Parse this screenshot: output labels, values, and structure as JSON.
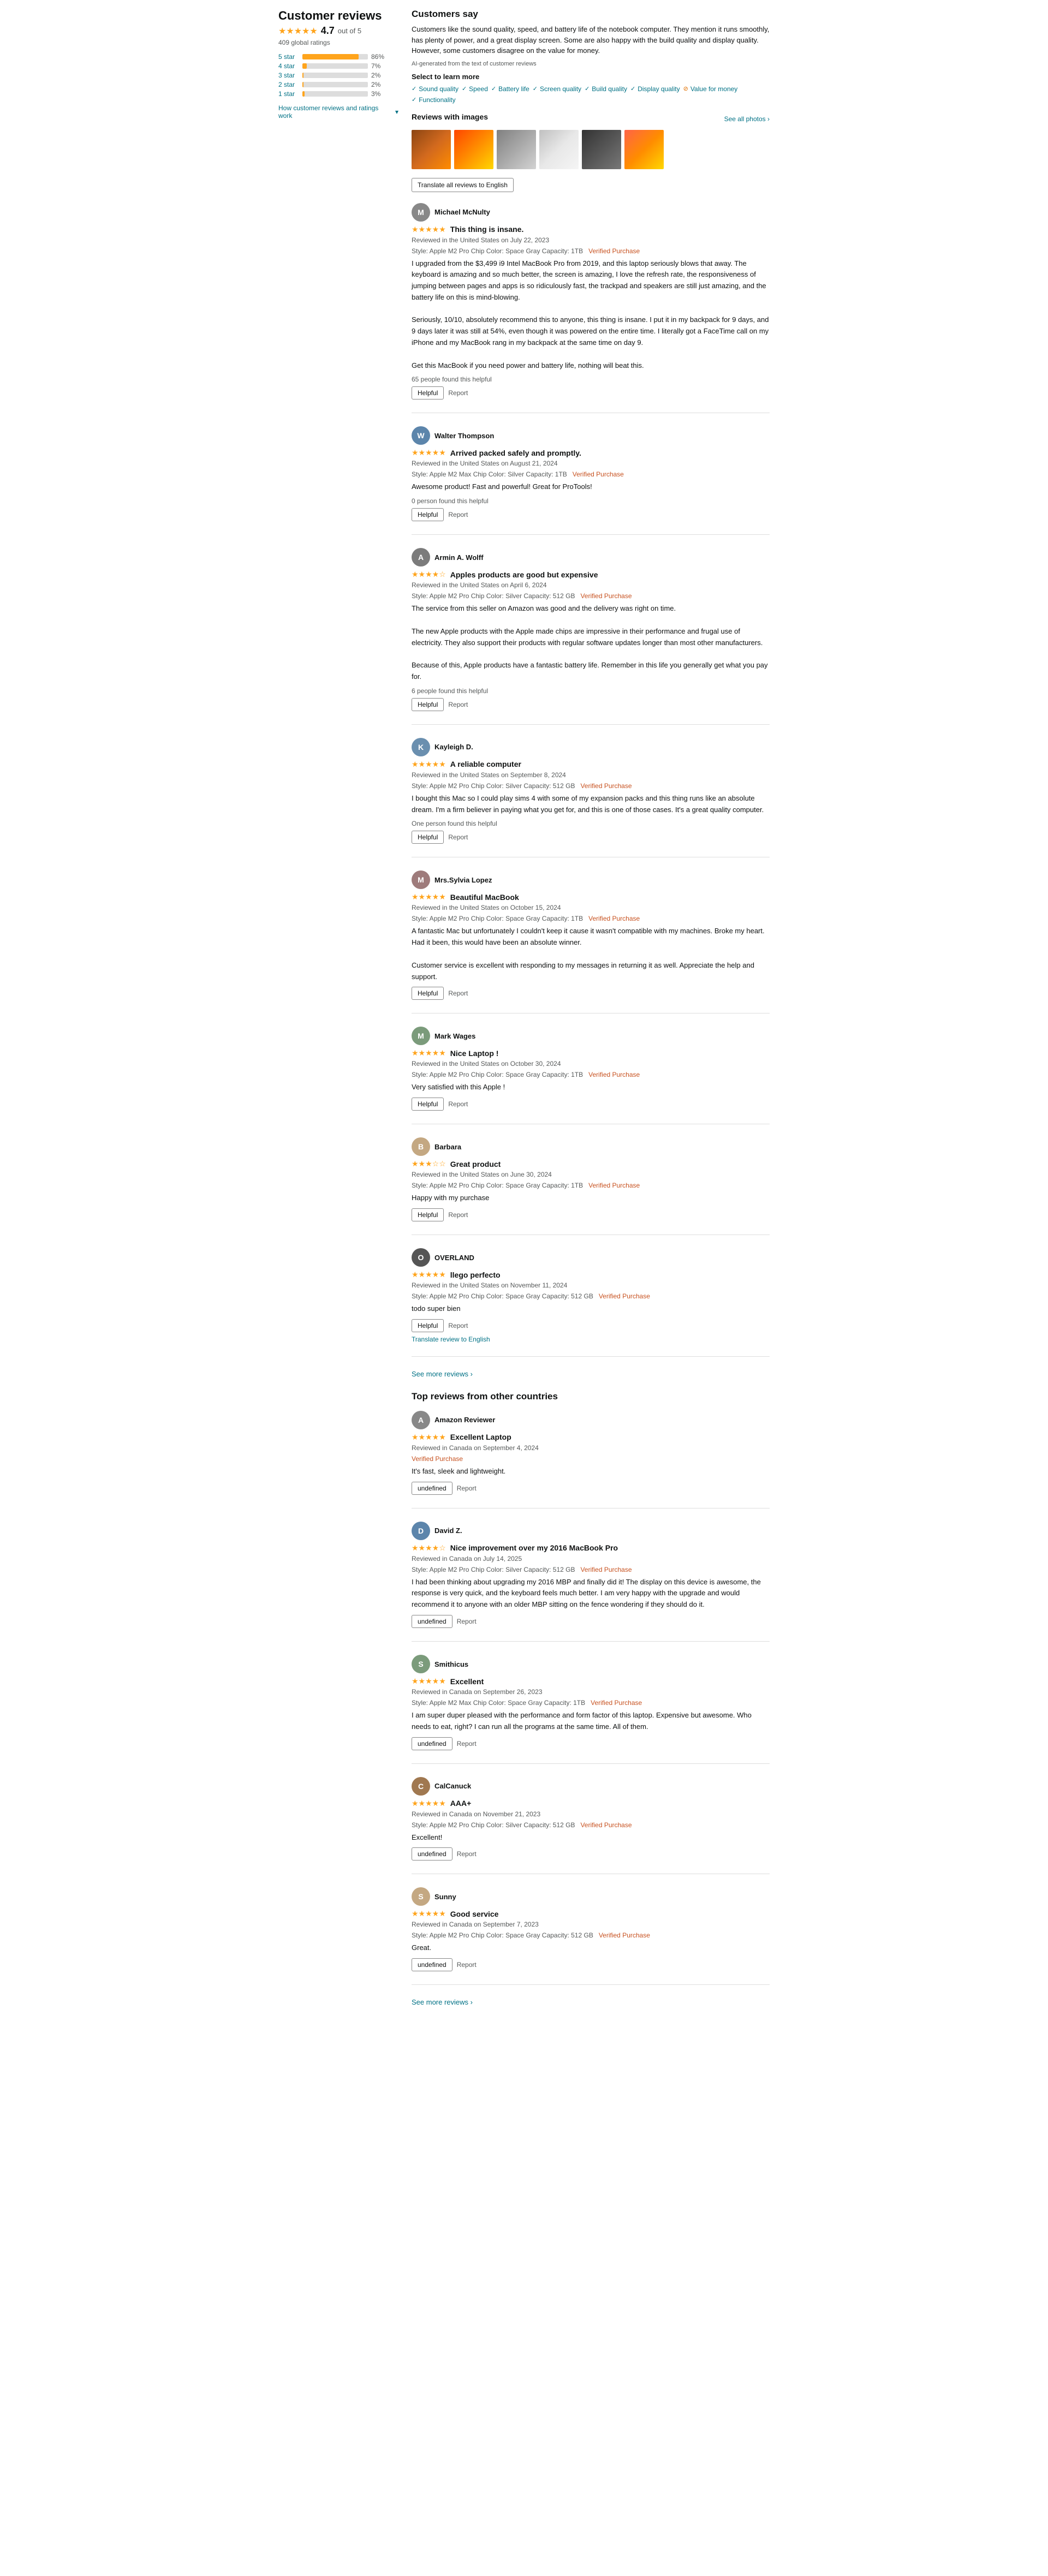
{
  "sidebar": {
    "title": "Customer reviews",
    "rating": "4.7",
    "out_of": "out of 5",
    "total_ratings": "409 global ratings",
    "how_work_label": "How customer reviews and ratings work",
    "stars": [
      {
        "label": "5 star",
        "pct": 86,
        "pct_label": "86%"
      },
      {
        "label": "4 star",
        "pct": 7,
        "pct_label": "7%"
      },
      {
        "label": "3 star",
        "pct": 2,
        "pct_label": "2%"
      },
      {
        "label": "2 star",
        "pct": 2,
        "pct_label": "2%"
      },
      {
        "label": "1 star",
        "pct": 3,
        "pct_label": "3%"
      }
    ]
  },
  "customers_say": {
    "header": "Customers say",
    "body": "Customers like the sound quality, speed, and battery life of the notebook computer. They mention it runs smoothly, has plenty of power, and a great display screen. Some are also happy with the build quality and display quality. However, some customers disagree on the value for money.",
    "ai_note": "AI-generated from the text of customer reviews",
    "select_learn": "Select to learn more",
    "tags": [
      {
        "label": "Sound quality",
        "type": "check"
      },
      {
        "label": "Speed",
        "type": "check"
      },
      {
        "label": "Battery life",
        "type": "check"
      },
      {
        "label": "Screen quality",
        "type": "check"
      },
      {
        "label": "Build quality",
        "type": "check"
      },
      {
        "label": "Display quality",
        "type": "check"
      },
      {
        "label": "Value for money",
        "type": "warn"
      },
      {
        "label": "Functionality",
        "type": "check"
      }
    ]
  },
  "reviews_images": {
    "header": "Reviews with images",
    "see_all": "See all photos ›",
    "translate_btn": "Translate all reviews to English"
  },
  "reviews": [
    {
      "id": 1,
      "avatar_letter": "M",
      "avatar_bg": "#888",
      "reviewer": "Michael McNulty",
      "stars": 5,
      "title": "This thing is insane.",
      "date": "Reviewed in the United States on July 22, 2023",
      "style": "Style: Apple M2 Pro Chip   Color: Space Gray   Capacity: 1TB",
      "verified": "Verified Purchase",
      "body": "I upgraded from the $3,499 i9 Intel MacBook Pro from 2019, and this laptop seriously blows that away. The keyboard is amazing and so much better, the screen is amazing, I love the refresh rate, the responsiveness of jumping between pages and apps is so ridiculously fast, the trackpad and speakers are still just amazing, and the battery life on this is mind-blowing.\n\nSeriously, 10/10, absolutely recommend this to anyone, this thing is insane. I put it in my backpack for 9 days, and 9 days later it was still at 54%, even though it was powered on the entire time. I literally got a FaceTime call on my iPhone and my MacBook rang in my backpack at the same time on day 9.\n\nGet this MacBook if you need power and battery life, nothing will beat this.",
      "helpful_count": "65 people found this helpful",
      "helpful_label": "Helpful",
      "report_label": "Report"
    },
    {
      "id": 2,
      "avatar_letter": "W",
      "avatar_bg": "#5C85AB",
      "reviewer": "Walter Thompson",
      "stars": 5,
      "title": "Arrived packed safely and promptly.",
      "date": "Reviewed in the United States on August 21, 2024",
      "style": "Style: Apple M2 Max Chip   Color: Silver   Capacity: 1TB",
      "verified": "Verified Purchase",
      "body": "Awesome product! Fast and powerful! Great for ProTools!",
      "helpful_count": "0 person found this helpful",
      "helpful_label": "Helpful",
      "report_label": "Report"
    },
    {
      "id": 3,
      "avatar_letter": "A",
      "avatar_bg": "#7B7B7B",
      "reviewer": "Armin A. Wolff",
      "stars": 4,
      "title": "Apples products are good but expensive",
      "date": "Reviewed in the United States on April 6, 2024",
      "style": "Style: Apple M2 Pro Chip   Color: Silver   Capacity: 512 GB",
      "verified": "Verified Purchase",
      "body": "The service from this seller on Amazon was good and the delivery was right on time.\n\nThe new Apple products with the Apple made chips are impressive in their performance and frugal use of electricity. They also support their products with regular software updates longer than most other manufacturers.\n\nBecause of this, Apple products have a fantastic battery life. Remember in this life you generally get what you pay for.",
      "helpful_count": "6 people found this helpful",
      "helpful_label": "Helpful",
      "report_label": "Report"
    },
    {
      "id": 4,
      "avatar_letter": "K",
      "avatar_bg": "#6A8FAF",
      "reviewer": "Kayleigh D.",
      "stars": 5,
      "title": "A reliable computer",
      "date": "Reviewed in the United States on September 8, 2024",
      "style": "Style: Apple M2 Pro Chip   Color: Silver   Capacity: 512 GB",
      "verified": "Verified Purchase",
      "body": "I bought this Mac so I could play sims 4 with some of my expansion packs and this thing runs like an absolute dream. I'm a firm believer in paying what you get for, and this is one of those cases. It's a great quality computer.",
      "helpful_count": "One person found this helpful",
      "helpful_label": "Helpful",
      "report_label": "Report"
    },
    {
      "id": 5,
      "avatar_letter": "M",
      "avatar_bg": "#9E7B7B",
      "reviewer": "Mrs.Sylvia Lopez",
      "stars": 5,
      "title": "Beautiful MacBook",
      "date": "Reviewed in the United States on October 15, 2024",
      "style": "Style: Apple M2 Pro Chip   Color: Space Gray   Capacity: 1TB",
      "verified": "Verified Purchase",
      "body": "A fantastic Mac but unfortunately I couldn't keep it cause it wasn't compatible with my machines. Broke my heart. Had it been, this would have been an absolute winner.\n\nCustomer service is excellent with responding to my messages in returning it as well. Appreciate the help and support.",
      "helpful_count": "",
      "helpful_label": "Helpful",
      "report_label": "Report"
    },
    {
      "id": 6,
      "avatar_letter": "M",
      "avatar_bg": "#7B9B7B",
      "reviewer": "Mark Wages",
      "stars": 5,
      "title": "Nice Laptop !",
      "date": "Reviewed in the United States on October 30, 2024",
      "style": "Style: Apple M2 Pro Chip   Color: Space Gray   Capacity: 1TB",
      "verified": "Verified Purchase",
      "body": "Very satisfied with this Apple !",
      "helpful_count": "",
      "helpful_label": "Helpful",
      "report_label": "Report"
    },
    {
      "id": 7,
      "avatar_letter": "B",
      "avatar_bg": "#C4A882",
      "reviewer": "Barbara",
      "stars": 3,
      "title": "Great product",
      "date": "Reviewed in the United States on June 30, 2024",
      "style": "Style: Apple M2 Pro Chip   Color: Space Gray   Capacity: 1TB",
      "verified": "Verified Purchase",
      "body": "Happy with my purchase",
      "helpful_count": "",
      "helpful_label": "Helpful",
      "report_label": "Report"
    },
    {
      "id": 8,
      "avatar_letter": "O",
      "avatar_bg": "#555",
      "reviewer": "OVERLAND",
      "stars": 5,
      "title": "llego perfecto",
      "date": "Reviewed in the United States on November 11, 2024",
      "style": "Style: Apple M2 Pro Chip   Color: Space Gray   Capacity: 512 GB",
      "verified": "Verified Purchase",
      "body": "todo super bien",
      "helpful_count": "",
      "helpful_label": "Helpful",
      "report_label": "Report",
      "translate_review": "Translate review to English"
    }
  ],
  "see_more_reviews": "See more reviews ›",
  "top_other_countries": {
    "header": "Top reviews from other countries",
    "reviews": [
      {
        "id": 101,
        "avatar_letter": "A",
        "avatar_bg": "#888",
        "reviewer": "Amazon Reviewer",
        "stars": 5,
        "title": "Excellent Laptop",
        "date": "Reviewed in Canada on September 4, 2024",
        "verified": "Verified Purchase",
        "style": "",
        "body": "It's fast, sleek and lightweight.",
        "report_label": "Report"
      },
      {
        "id": 102,
        "avatar_letter": "D",
        "avatar_bg": "#5C85AB",
        "reviewer": "David Z.",
        "stars": 4,
        "title": "Nice improvement over my 2016 MacBook Pro",
        "date": "Reviewed in Canada on July 14, 2025",
        "style": "Style: Apple M2 Pro Chip   Color: Silver   Capacity: 512 GB",
        "verified": "Verified Purchase",
        "body": "I had been thinking about upgrading my 2016 MBP and finally did it! The display on this device is awesome, the response is very quick, and the keyboard feels much better. I am very happy with the upgrade and would recommend it to anyone with an older MBP sitting on the fence wondering if they should do it.",
        "report_label": "Report"
      },
      {
        "id": 103,
        "avatar_letter": "S",
        "avatar_bg": "#7B9B7B",
        "reviewer": "Smithicus",
        "stars": 5,
        "title": "Excellent",
        "date": "Reviewed in Canada on September 26, 2023",
        "style": "Style: Apple M2 Max Chip   Color: Space Gray   Capacity: 1TB",
        "verified": "Verified Purchase",
        "body": "I am super duper pleased with the performance and form factor of this laptop. Expensive but awesome. Who needs to eat, right? I can run all the programs at the same time. All of them.",
        "report_label": "Report"
      },
      {
        "id": 104,
        "avatar_letter": "C",
        "avatar_bg": "#A07850",
        "reviewer": "CalCanuck",
        "stars": 5,
        "title": "AAA+",
        "date": "Reviewed in Canada on November 21, 2023",
        "style": "Style: Apple M2 Pro Chip   Color: Silver   Capacity: 512 GB",
        "verified": "Verified Purchase",
        "body": "Excellent!",
        "report_label": "Report"
      },
      {
        "id": 105,
        "avatar_letter": "S",
        "avatar_bg": "#C4A882",
        "reviewer": "Sunny",
        "stars": 5,
        "title": "Good service",
        "date": "Reviewed in Canada on September 7, 2023",
        "style": "Style: Apple M2 Pro Chip   Color: Space Gray   Capacity: 512 GB",
        "verified": "Verified Purchase",
        "body": "Great.",
        "report_label": "Report"
      }
    ],
    "see_more": "See more reviews ›"
  }
}
